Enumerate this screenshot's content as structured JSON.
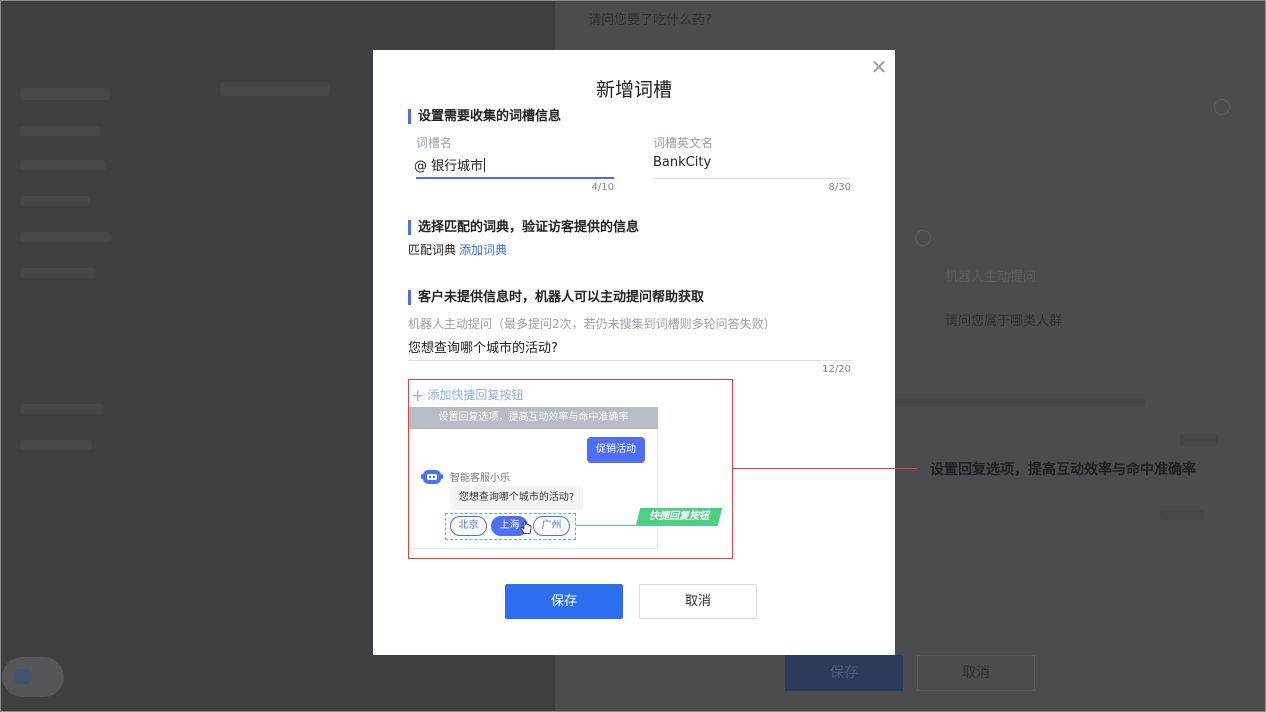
{
  "background": {
    "question_top": "请问您要了吃什么药?",
    "bot_question_label": "机器人主动提问",
    "bot_question_value": "请问您属于哪类人群",
    "save_label": "保存",
    "cancel_label": "取消"
  },
  "modal": {
    "title": "新增词槽",
    "close_icon": "close-icon",
    "section1": {
      "title": "设置需要收集的词槽信息",
      "name_label": "词槽名",
      "name_value": "@ 银行城市",
      "name_count": "4/10",
      "en_label": "词槽英文名",
      "en_value": "BankCity",
      "en_count": "8/30"
    },
    "section2": {
      "title": "选择匹配的词典，验证访客提供的信息",
      "dict_label": "匹配词典",
      "add_dict_link": "添加词典"
    },
    "section3": {
      "title": "客户未提供信息时，机器人可以主动提问帮助获取",
      "hint": "机器人主动提问（最多提问2次，若仍未搜集到词槽则多轮问答失败）",
      "question_value": "您想查询哪个城市的活动?",
      "question_count": "12/20"
    },
    "quick_reply": {
      "add_button": "添加快捷回复按钮",
      "preview_bar": "设置回复选项，提高互动效率与命中准确率",
      "user_bubble": "促销活动",
      "bot_name": "智能客服小乐",
      "bot_bubble": "您想查询哪个城市的活动?",
      "chips": [
        "北京",
        "上海",
        "广州"
      ],
      "selected_chip": "上海",
      "tag": "快捷回复按钮"
    },
    "save_button": "保存",
    "cancel_button": "取消"
  },
  "annotation": "设置回复选项，提高互动效率与命中准确率",
  "colors": {
    "accent": "#2d6ff0",
    "highlight": "#e0453d",
    "tag_green": "#4fcf86"
  }
}
